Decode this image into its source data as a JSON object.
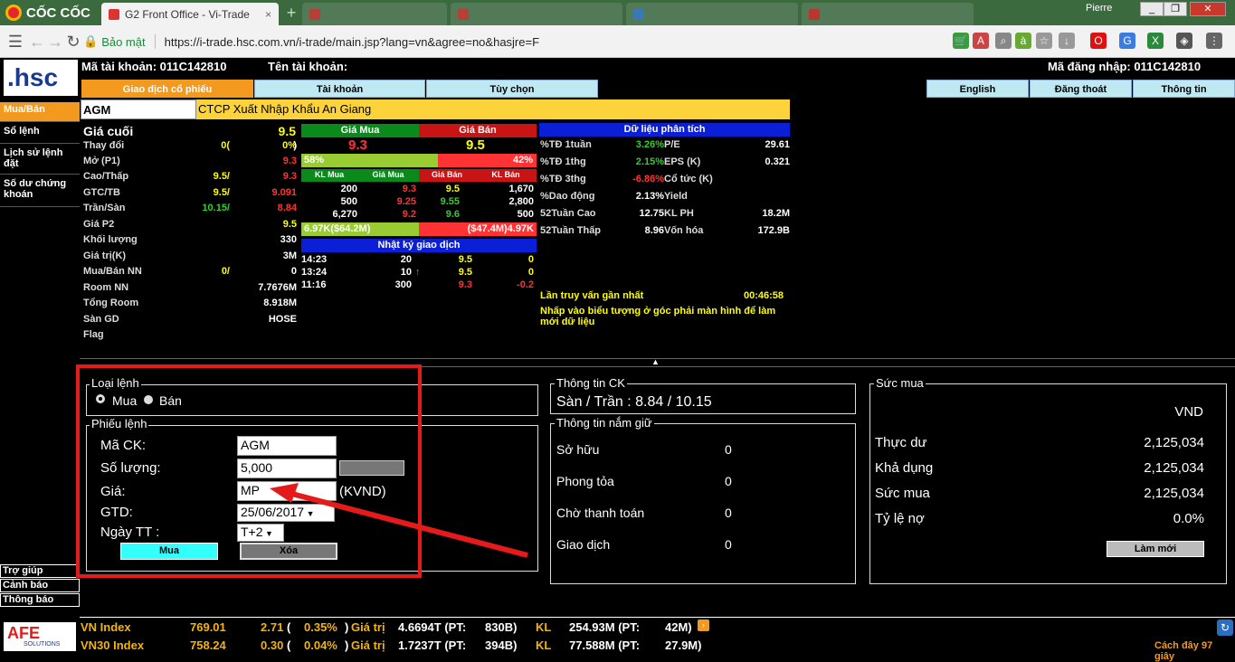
{
  "browser": {
    "brand": "CỐC CỐC",
    "active_tab": "G2 Front Office - Vi-Trade",
    "tab_close": "×",
    "new_tab": "+",
    "profile": "Pierre",
    "url_secure": "Bảo mật",
    "url": "https://i-trade.hsc.com.vn/i-trade/main.jsp?lang=vn&agree=no&hasjre=F"
  },
  "account": {
    "logo": ".hsc",
    "account_label": "Mã tài khoản: 011C142810",
    "name_label": "Tên tài khoản:",
    "login_label": "Mã đăng nhập: 011C142810"
  },
  "topnav": {
    "stock_trading": "Giao dịch cổ phiếu",
    "account": "Tài khoản",
    "options": "Tùy chọn",
    "english": "English",
    "logout": "Đăng thoát",
    "info": "Thông tin"
  },
  "sidebar": {
    "items": [
      "Mua/Bán",
      "Sổ lệnh",
      "Lịch sử lệnh đặt",
      "Số dư chứng khoán"
    ],
    "bottom": [
      "Trợ giúp",
      "Cảnh báo",
      "Thông báo"
    ]
  },
  "stock": {
    "code": "AGM",
    "name": "CTCP Xuất Nhập Khẩu An Giang"
  },
  "price_info": {
    "rows": [
      {
        "label": "Giá cuối",
        "a": "9.5",
        "b": ""
      },
      {
        "label": "Thay đổi",
        "a": "0(",
        "b": "0%"
      },
      {
        "label": "Mở (P1)",
        "a": "",
        "b": "9.3"
      },
      {
        "label": "Cao/Thấp",
        "a": "9.5/",
        "b": "9.3"
      },
      {
        "label": "GTC/TB",
        "a": "9.5/",
        "b": "9.091"
      },
      {
        "label": "Trần/Sàn",
        "a": "10.15/",
        "b": "8.84"
      },
      {
        "label": "Giá P2",
        "a": "",
        "b": "9.5"
      },
      {
        "label": "Khối lượng",
        "a": "",
        "b": "330"
      },
      {
        "label": "Giá trị(K)",
        "a": "",
        "b": "3M"
      },
      {
        "label": "Mua/Bán NN",
        "a": "0/",
        "b": "0"
      },
      {
        "label": "Room NN",
        "a": "",
        "b": "7.7676M"
      },
      {
        "label": "Tổng Room",
        "a": "",
        "b": "8.918M"
      },
      {
        "label": "Sàn GD",
        "a": "",
        "b": "HOSE"
      },
      {
        "label": "Flag",
        "a": "",
        "b": ""
      }
    ],
    "change_close": ")"
  },
  "orderbook": {
    "buy_header": "Giá Mua",
    "sell_header": "Giá Bán",
    "best_buy": "9.3",
    "best_sell": "9.5",
    "buy_pct": "58%",
    "sell_pct": "42%",
    "buy_pct_value": 58,
    "col_headers": [
      "KL Mua",
      "Giá Mua",
      "Giá Bán",
      "KL Bán"
    ],
    "rows": [
      [
        "200",
        "9.3",
        "9.5",
        "1,670"
      ],
      [
        "500",
        "9.25",
        "9.55",
        "2,800"
      ],
      [
        "6,270",
        "9.2",
        "9.6",
        "500"
      ]
    ],
    "total_buy": "6.97K($64.2M)",
    "total_sell": "($47.4M)4.97K"
  },
  "trade_log": {
    "header": "Nhật ký giao dịch",
    "rows": [
      {
        "time": "14:23",
        "vol": "20",
        "arrow": "",
        "price": "9.5",
        "chg": "0"
      },
      {
        "time": "13:24",
        "vol": "10",
        "arrow": "↑",
        "price": "9.5",
        "chg": "0"
      },
      {
        "time": "11:16",
        "vol": "300",
        "arrow": "",
        "price": "9.3",
        "chg": "-0.2"
      }
    ]
  },
  "analysis": {
    "header": "Dữ liệu phân tích",
    "rows": [
      {
        "l1": "%TĐ 1tuần",
        "v1": "3.26%",
        "l2": "P/E",
        "v2": "29.61",
        "c": "grn"
      },
      {
        "l1": "%TĐ 1thg",
        "v1": "2.15%",
        "l2": "EPS (K)",
        "v2": "0.321",
        "c": "grn"
      },
      {
        "l1": "%TĐ 3thg",
        "v1": "-6.86%",
        "l2": "Cổ tức (K)",
        "v2": "",
        "c": "red"
      },
      {
        "l1": "%Dao động",
        "v1": "2.13%",
        "l2": "Yield",
        "v2": "",
        "c": "wht"
      },
      {
        "l1": "52Tuần Cao",
        "v1": "12.75",
        "l2": "KL PH",
        "v2": "18.2M",
        "c": "wht"
      },
      {
        "l1": "52Tuần Thấp",
        "v1": "8.96",
        "l2": "Vốn hóa",
        "v2": "172.9B",
        "c": "wht"
      }
    ],
    "last_query_label": "Lần truy vấn gần nhất",
    "last_query_time": "00:46:58",
    "hint": "Nhấp vào biểu tượng ở góc phải màn hình để làm mới dữ liệu"
  },
  "splitter": "▲",
  "order_form": {
    "order_type_legend": "Loại lệnh",
    "buy_radio": "Mua",
    "sell_radio": "Bán",
    "ticket_legend": "Phiếu lệnh",
    "symbol_label": "Mã CK:",
    "symbol_value": "AGM",
    "qty_label": "Số lượng:",
    "qty_value": "5,000",
    "price_label": "Giá:",
    "price_value": "MP",
    "price_unit": "(KVND)",
    "gtd_label": "GTD:",
    "gtd_value": "25/06/2017",
    "settle_label": "Ngày TT :",
    "settle_value": "T+2",
    "buy_button": "Mua",
    "clear_button": "Xóa"
  },
  "stock_info": {
    "legend": "Thông tin CK",
    "floor_ceiling": "Sàn / Trần : 8.84 / 10.15"
  },
  "holdings": {
    "legend": "Thông tin nắm giữ",
    "rows": [
      {
        "label": "Sở hữu",
        "value": "0"
      },
      {
        "label": "Phong tỏa",
        "value": "0"
      },
      {
        "label": "Chờ thanh toán",
        "value": "0"
      },
      {
        "label": "Giao dịch",
        "value": "0"
      }
    ]
  },
  "buying_power": {
    "legend": "Sức mua",
    "currency": "VND",
    "rows": [
      {
        "label": "Thực dư",
        "value": "2,125,034"
      },
      {
        "label": "Khả dụng",
        "value": "2,125,034"
      },
      {
        "label": "Sức mua",
        "value": "2,125,034"
      },
      {
        "label": "Tỷ lệ nợ",
        "value": "0.0%"
      }
    ],
    "refresh_button": "Làm mới"
  },
  "ticker": {
    "rows": [
      {
        "name": "VN Index",
        "value": "769.01",
        "chg": "2.71",
        "pct": "0.35%",
        "gt_label": "Giá trị",
        "gt": "4.6694T (PT:",
        "pt": "830B)",
        "kl_label": "KL",
        "kl": "254.93M (PT:",
        "klpt": "42M)"
      },
      {
        "name": "VN30 Index",
        "value": "758.24",
        "chg": "0.30",
        "pct": "0.04%",
        "gt_label": "Giá trị",
        "gt": "1.7237T (PT:",
        "pt": "394B)",
        "kl_label": "KL",
        "kl": "77.588M (PT:",
        "klpt": "27.9M)"
      }
    ],
    "updated": "Cách đây 97 giây",
    "afe_logo": "AFE",
    "afe_sub": "SOLUTIONS"
  },
  "colors": {
    "accent_orange": "#f39a1e",
    "annotation_red": "#e51b1b",
    "buy_green": "#0b8a1c",
    "sell_red": "#c81414",
    "info_blue": "#0a1fd6"
  }
}
